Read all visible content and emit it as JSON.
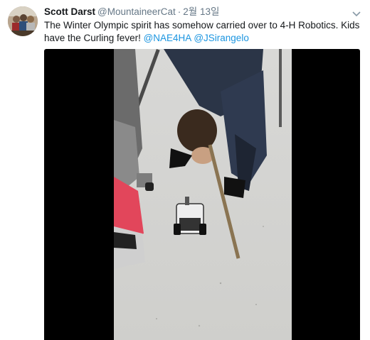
{
  "tweet": {
    "author_name": "Scott Darst",
    "author_handle": "@MountaineerCat",
    "separator": "·",
    "date": "2월 13일",
    "text_plain": "The Winter Olympic spirit has somehow carried over to 4-H Robotics.  Kids have the Curling fever! ",
    "mentions": [
      "@NAE4HA",
      "@JSirangelo"
    ]
  },
  "icons": {
    "avatar": "profile-photo",
    "caret": "chevron-down-icon"
  },
  "colors": {
    "link": "#1b95e0",
    "secondary": "#657786",
    "primary_text": "#14171a",
    "media_background": "#000000"
  }
}
